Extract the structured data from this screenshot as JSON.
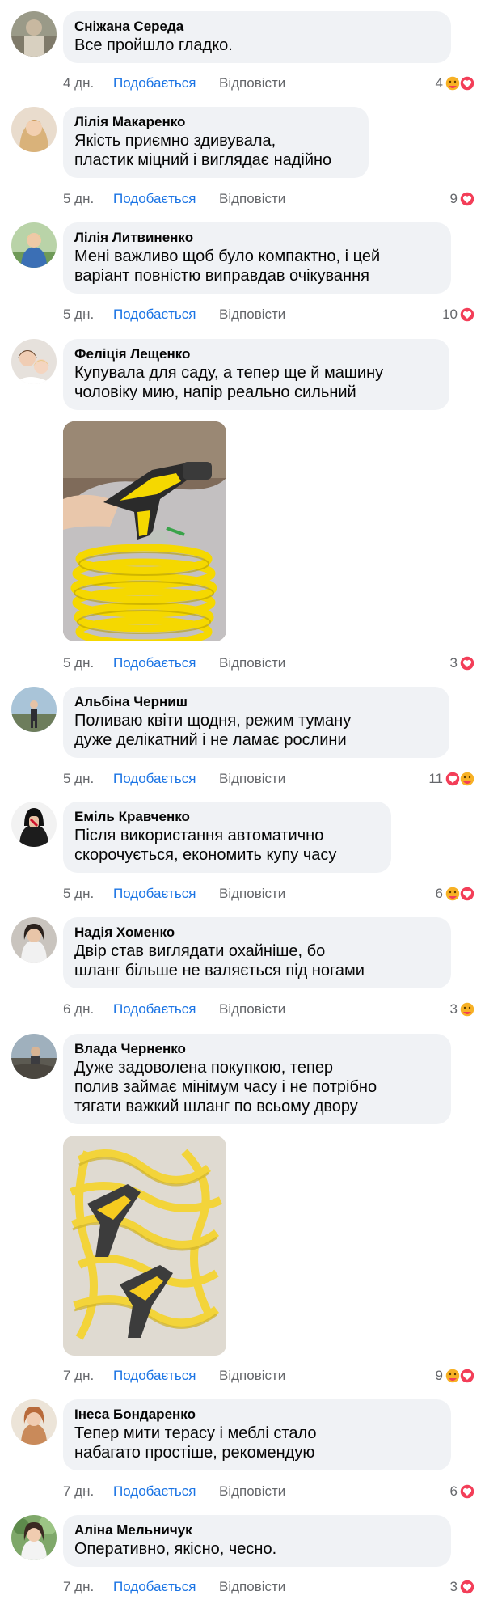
{
  "actions": {
    "like_label": "Подобається",
    "reply_label": "Відповісти"
  },
  "comments": [
    {
      "name": "Сніжана Середа",
      "text": "Все пройшло гладко.",
      "time": "4 дн.",
      "reactions_count": "4",
      "reactions": [
        "care",
        "love"
      ]
    },
    {
      "name": "Лілія Макаренко",
      "text": "Якість приємно здивувала,\nпластик міцний і виглядає надійно",
      "time": "5 дн.",
      "reactions_count": "9",
      "reactions": [
        "love"
      ]
    },
    {
      "name": "Лілія Литвиненко",
      "text": "Мені важливо щоб було компактно, і цей\nваріант повністю виправдав очікування",
      "time": "5 дн.",
      "reactions_count": "10",
      "reactions": [
        "love"
      ]
    },
    {
      "name": "Феліція Лещенко",
      "text": "Купувала для саду, а тепер ще й машину\nчоловіку мию, напір реально сильний",
      "time": "5 дн.",
      "reactions_count": "3",
      "reactions": [
        "love"
      ],
      "photo": "yellow-spiral-hose-with-spray-gun"
    },
    {
      "name": "Альбіна Черниш",
      "text": "Поливаю квіти щодня, режим туману\nдуже делікатний і не ламає рослини",
      "time": "5 дн.",
      "reactions_count": "11",
      "reactions": [
        "love",
        "care"
      ]
    },
    {
      "name": "Еміль Кравченко",
      "text": "Після використання автоматично\nскорочується, економить купу часу",
      "time": "5 дн.",
      "reactions_count": "6",
      "reactions": [
        "care",
        "love"
      ]
    },
    {
      "name": "Надія Хоменко",
      "text": "Двір став виглядати охайніше, бо\nшланг більше не валяється під ногами",
      "time": "6 дн.",
      "reactions_count": "3",
      "reactions": [
        "care"
      ]
    },
    {
      "name": "Влада Черненко",
      "text": "Дуже задоволена покупкою, тепер\nполив займає мінімум часу і не потрібно\nтягати важкий шланг по всьому двору",
      "time": "7 дн.",
      "reactions_count": "9",
      "reactions": [
        "care",
        "love"
      ],
      "photo": "yellow-coiled-hoses-in-package"
    },
    {
      "name": "Інеса Бондаренко",
      "text": "Тепер мити терасу і меблі стало\nнабагато простіше, рекомендую",
      "time": "7 дн.",
      "reactions_count": "6",
      "reactions": [
        "love"
      ]
    },
    {
      "name": "Аліна Мельничук",
      "text": "Оперативно, якісно, чесно.",
      "time": "7 дн.",
      "reactions_count": "3",
      "reactions": [
        "love"
      ]
    }
  ],
  "colors": {
    "bubble_bg": "#f0f2f5",
    "link_blue": "#1b74e4",
    "meta_gray": "#65676b",
    "love_red": "#f33e58",
    "care_yellow": "#f7b125",
    "hose_yellow": "#f5d800"
  }
}
